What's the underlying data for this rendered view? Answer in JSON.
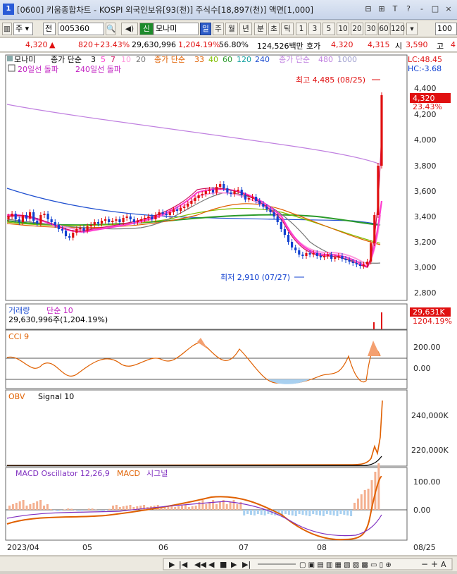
{
  "window": {
    "number": "1",
    "title": "[0600] 키움종합차트 - KOSPI 외국인보유[93(천)] 주식수[18,897(천)] 액면[1,000]",
    "controls": [
      "⊟",
      "⊞",
      "T",
      "?",
      "-",
      "□",
      "×"
    ]
  },
  "toolbar": {
    "market": "주",
    "all": "전",
    "code": "005360",
    "stock_name": "모나미",
    "new_badge": "신",
    "periods": [
      "일",
      "주",
      "월",
      "년",
      "분",
      "초",
      "틱"
    ],
    "active_period": "일",
    "intervals": [
      "1",
      "3",
      "5",
      "10",
      "20",
      "30",
      "60",
      "120"
    ],
    "count": "100"
  },
  "quote": {
    "price": "4,320",
    "change": "820",
    "change_pct": "+23.43%",
    "volume": "29,630,996",
    "volume_ratio": "1,204.19%",
    "foreign_ratio": "56.80%",
    "amount": "124,526백만",
    "ask_label": "호가",
    "ask": "4,320",
    "bid": "4,315",
    "open_label": "시",
    "open": "3,590",
    "high_label": "고",
    "high": "4"
  },
  "chart": {
    "price_legend": {
      "name": "모나미",
      "ma_prefix": "종가 단순",
      "ma_values": [
        "3",
        "5",
        "7",
        "10",
        "20"
      ],
      "ma2_prefix": "종가 단순",
      "ma2_values": [
        "33",
        "40",
        "60",
        "120",
        "240"
      ],
      "ma3_prefix": "종가 단순",
      "ma3_values": [
        "480",
        "1000"
      ],
      "signals": [
        "20일선 돌파",
        "240일선 돌파"
      ],
      "lc": "LC:48.45",
      "hc": "HC:-3.68"
    },
    "price_axis": [
      "4,400",
      "4,200",
      "4,000",
      "3,800",
      "3,600",
      "3,400",
      "3,200",
      "3,000",
      "2,800"
    ],
    "current_price": "4,320",
    "current_pct": "23.43%",
    "annotations": {
      "high": "최고 4,485 (08/25)",
      "low": "최저 2,910 (07/27)"
    },
    "volume_panel": {
      "title": "거래량",
      "ma": "단순 10",
      "info": "29,630,996주(1,204.19%)",
      "value": "29,631K",
      "pct": "1204.19%"
    },
    "cci_panel": {
      "title": "CCI 9",
      "axis": [
        "200.00",
        "0.00"
      ]
    },
    "obv_panel": {
      "title": "OBV",
      "signal": "Signal 10",
      "axis": [
        "240,000K",
        "220,000K"
      ]
    },
    "macd_panel": {
      "title": "MACD Oscillator 12,26,9",
      "macd": "MACD",
      "signal": "시그널",
      "axis": [
        "100.00",
        "0.00"
      ]
    },
    "x_axis": [
      "2023/04",
      "05",
      "06",
      "07",
      "08",
      "08/25"
    ],
    "colors": {
      "up": "#e01010",
      "down": "#1040d0",
      "ma5": "#ff3ccf",
      "ma240": "#1f4fd0",
      "ma480": "#c080e0",
      "macd": "#ff6a00",
      "signal": "#8030c0"
    }
  }
}
